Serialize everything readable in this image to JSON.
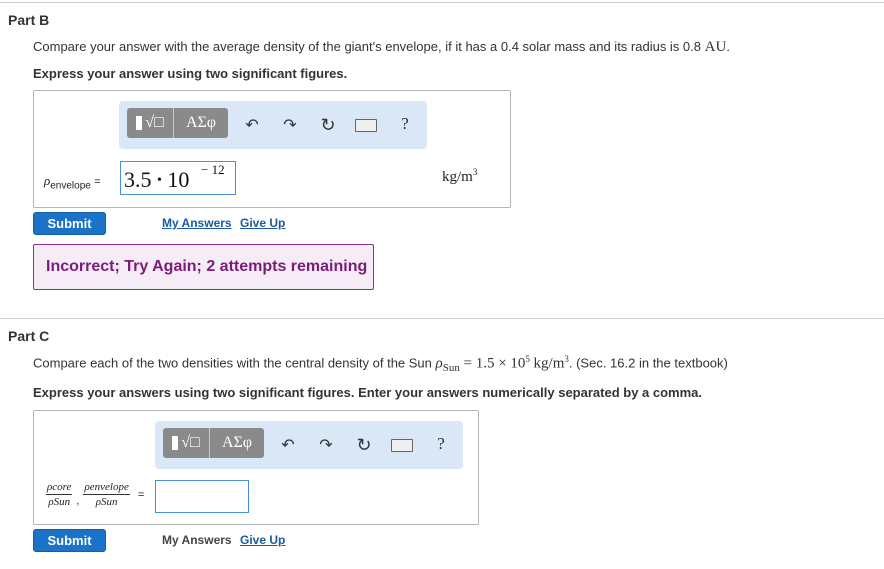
{
  "part_b": {
    "title": "Part B",
    "question_text": "Compare your answer with the average density of the giant's envelope, if it has a 0.4 solar mass and its radius is 0.8",
    "question_unit": "AU",
    "question_end": ".",
    "instruction": "Express your answer using two significant figures.",
    "toolbar": {
      "template_label": "√□",
      "greek_label": "ΑΣφ",
      "undo_icon": "undo-arrow",
      "redo_icon": "redo-arrow",
      "reset_icon": "reset-circle-arrow",
      "keyboard_icon": "keyboard",
      "help_label": "?"
    },
    "answer_label_symbol": "ρ",
    "answer_label_sub": "envelope",
    "answer_equals": "=",
    "answer_mantissa": "3.5",
    "answer_dot": "•",
    "answer_base": "10",
    "answer_exponent": "− 12",
    "unit_base": "kg/m",
    "unit_exp": "3",
    "submit_label": "Submit",
    "my_answers_label": "My Answers",
    "give_up_label": "Give Up",
    "feedback": "Incorrect; Try Again; 2 attempts remaining"
  },
  "part_c": {
    "title": "Part C",
    "question_text": "Compare each of the two densities with the central density of the Sun",
    "sun_symbol": "ρ",
    "sun_sub": "Sun",
    "sun_value": "= 1.5 × 10",
    "sun_exp": "5",
    "sun_unit": "kg/m",
    "sun_unit_exp": "3",
    "question_end": ". (Sec. 16.2 in the textbook)",
    "instruction": "Express your answers using two significant figures. Enter your answers numerically separated by a comma.",
    "toolbar": {
      "template_label": "√□",
      "greek_label": "ΑΣφ",
      "undo_icon": "undo-arrow",
      "redo_icon": "redo-arrow",
      "reset_icon": "reset-circle-arrow",
      "keyboard_icon": "keyboard",
      "help_label": "?"
    },
    "frac1_num": "ρcore",
    "frac1_den": "ρSun",
    "frac2_num": "ρenvelope",
    "frac2_den": "ρSun",
    "comma": ",",
    "answer_equals": "=",
    "answer_value": "",
    "submit_label": "Submit",
    "my_answers_label": "My Answers",
    "give_up_label": "Give Up"
  },
  "colors": {
    "submit_bg": "#1a73c7",
    "toolbar_bg": "#d9e7f7",
    "feedback_border": "#8e2d8e",
    "feedback_text": "#7a1c7a",
    "link": "#1a5aa0"
  }
}
